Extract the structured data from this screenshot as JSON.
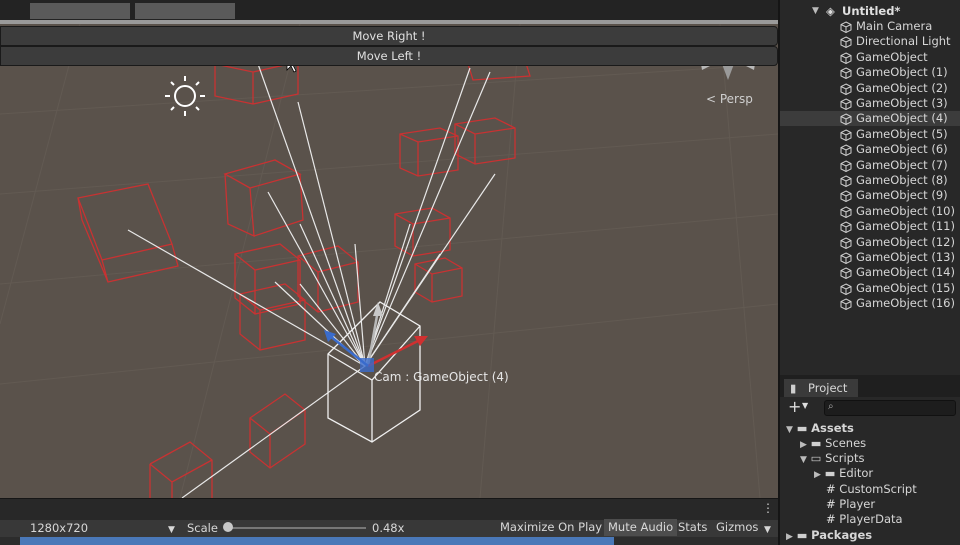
{
  "scene": {
    "buttons": {
      "move_right": "Move Right !",
      "move_left": "Move Left !"
    },
    "persp_label": "< Persp",
    "selected_label": "Cam : GameObject (4)"
  },
  "game_bar": {
    "resolution": "1280x720",
    "scale_label": "Scale",
    "scale_value": "0.48x",
    "maximize": "Maximize On Play",
    "mute": "Mute Audio",
    "stats": "Stats",
    "gizmos": "Gizmos"
  },
  "hierarchy": {
    "scene_name": "Untitled*",
    "items": [
      "Main Camera",
      "Directional Light",
      "GameObject",
      "GameObject (1)",
      "GameObject (2)",
      "GameObject (3)",
      "GameObject (4)",
      "GameObject (5)",
      "GameObject (6)",
      "GameObject (7)",
      "GameObject (8)",
      "GameObject (9)",
      "GameObject (10)",
      "GameObject (11)",
      "GameObject (12)",
      "GameObject (13)",
      "GameObject (14)",
      "GameObject (15)",
      "GameObject (16)"
    ],
    "selected_index": 6
  },
  "project": {
    "tab": "Project",
    "assets": "Assets",
    "scenes": "Scenes",
    "scripts": "Scripts",
    "editor": "Editor",
    "script_files": [
      "CustomScript",
      "Player",
      "PlayerData"
    ],
    "packages": "Packages"
  },
  "colors": {
    "scene_bg": "#5a524b",
    "selection_red": "#c83232",
    "accent_blue": "#4a78b8"
  }
}
